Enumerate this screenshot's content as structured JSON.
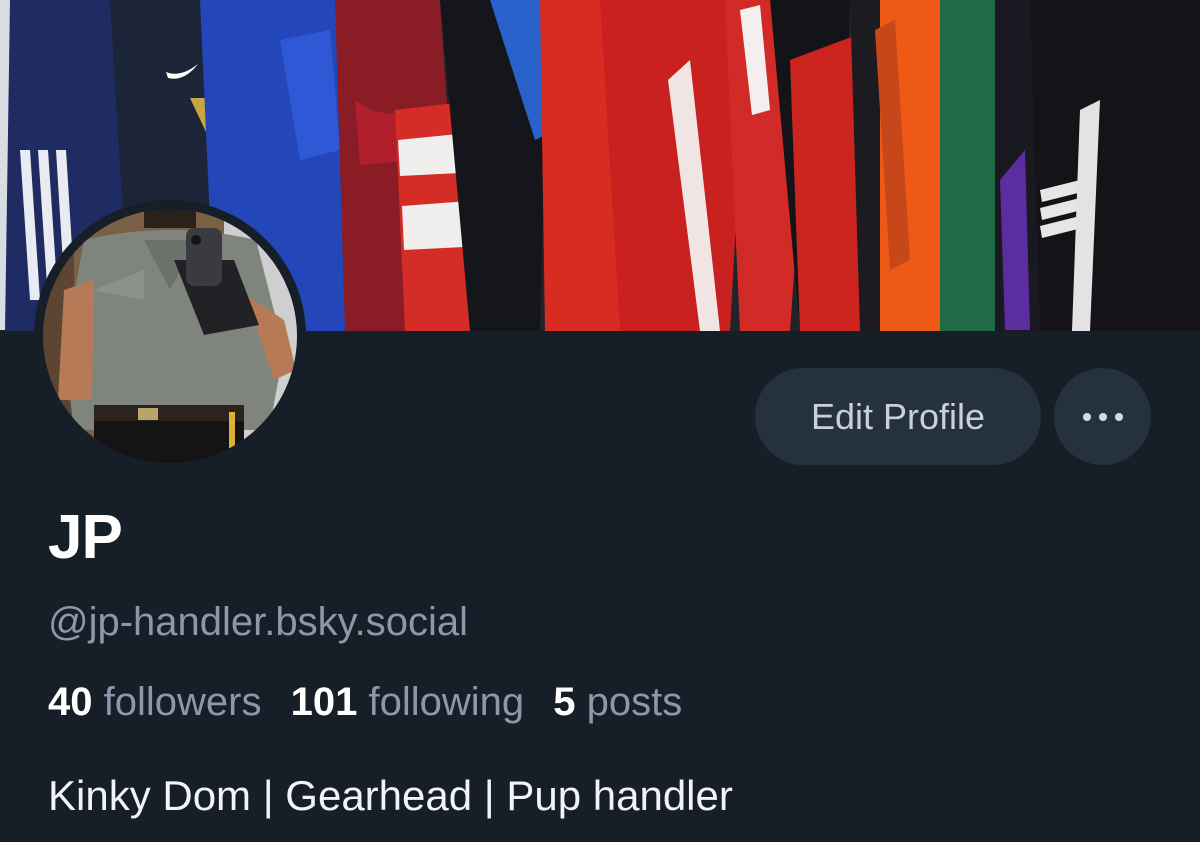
{
  "profile": {
    "display_name": "JP",
    "handle": "@jp-handler.bsky.social",
    "bio": "Kinky Dom | Gearhead | Pup handler"
  },
  "stats": {
    "followers_count": "40",
    "followers_label": "followers",
    "following_count": "101",
    "following_label": "following",
    "posts_count": "5",
    "posts_label": "posts"
  },
  "actions": {
    "edit_profile_label": "Edit Profile"
  },
  "icons": {
    "more": "more-horizontal-icon"
  },
  "colors": {
    "background": "#161e27",
    "button_bg": "#26313f",
    "muted_text": "#8a98aa"
  }
}
